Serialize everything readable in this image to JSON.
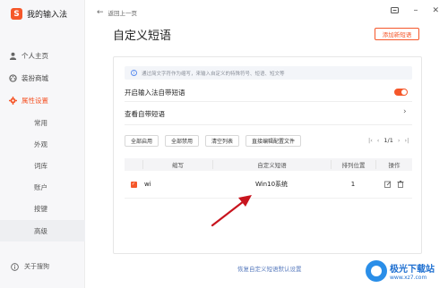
{
  "app": {
    "title": "我的输入法",
    "logo_char": "S"
  },
  "sidebar": {
    "items": [
      {
        "label": "个人主页",
        "icon": "user-icon"
      },
      {
        "label": "装扮商城",
        "icon": "palette-icon"
      },
      {
        "label": "属性设置",
        "icon": "gear-icon",
        "active": true
      }
    ],
    "sub_items": [
      {
        "label": "常用"
      },
      {
        "label": "外观"
      },
      {
        "label": "词库"
      },
      {
        "label": "账户"
      },
      {
        "label": "按键"
      },
      {
        "label": "高级",
        "active": true
      }
    ],
    "about": "关于搜狗"
  },
  "topbar": {
    "back_label": "返回上一页"
  },
  "main": {
    "title": "自定义短语",
    "add_button": "添加新短语",
    "notice": "通过简文字符作为缩写，来输入自定义的特殊符号、短语、短文等",
    "toggle_label": "开启输入法自带短语",
    "toggle_on": true,
    "view_label": "查看自带短语",
    "toolbar": [
      "全部启用",
      "全部禁用",
      "清空列表",
      "直接编辑配置文件"
    ],
    "pager": {
      "current": "1/1"
    },
    "table": {
      "headers": {
        "abbr": "缩写",
        "phrase": "自定义短语",
        "position": "排列位置",
        "ops": "操作"
      },
      "rows": [
        {
          "checked": true,
          "abbr": "wi",
          "phrase": "Win10系统",
          "position": "1"
        }
      ]
    },
    "restore_link": "恢复自定义短语默认设置"
  },
  "watermark": {
    "title": "极光下载站",
    "url": "www.xz7.com"
  },
  "colors": {
    "accent": "#f5572a",
    "link": "#5b7dbf",
    "annotation_arrow": "#c8141e"
  }
}
